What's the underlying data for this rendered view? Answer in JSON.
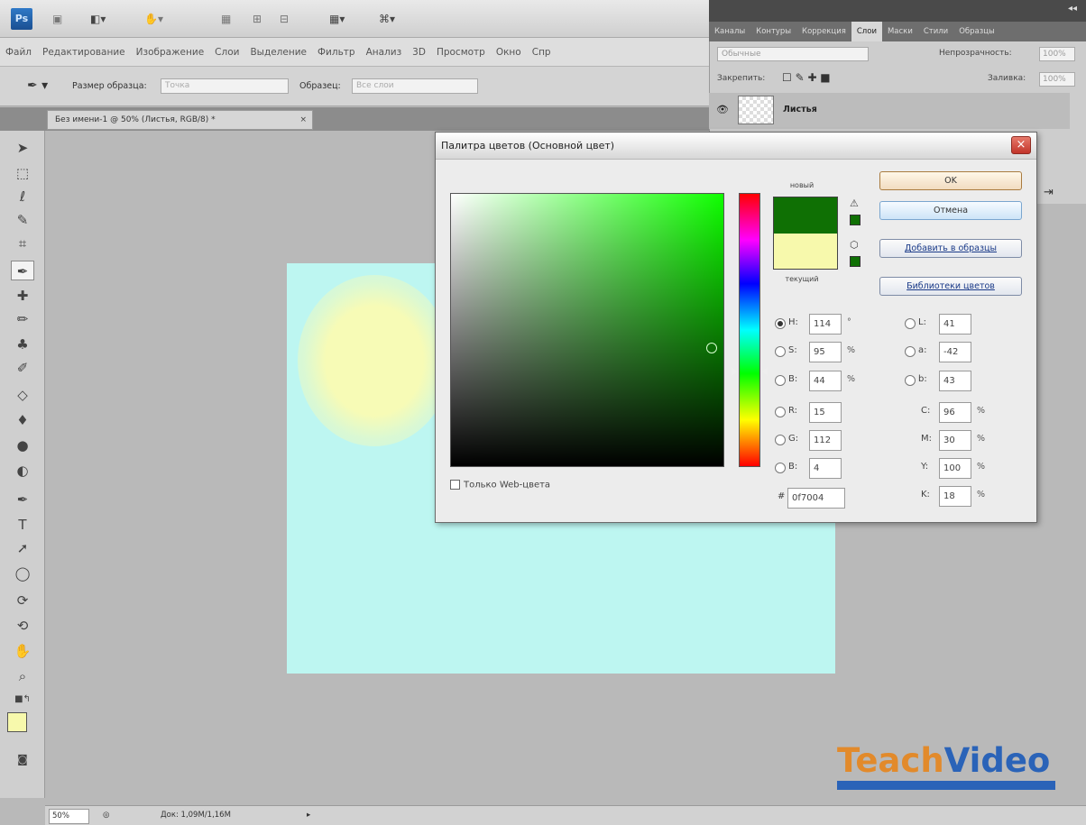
{
  "app": {
    "logo": "Ps",
    "menu": [
      "Файл",
      "Редактирование",
      "Изображение",
      "Слои",
      "Выделение",
      "Фильтр",
      "Анализ",
      "3D",
      "Просмотр",
      "Окно",
      "Спр"
    ],
    "options": {
      "sample_size_label": "Размер образца:",
      "sample_size_value": "Точка",
      "sample_label": "Образец:",
      "sample_value": "Все слои"
    }
  },
  "document": {
    "tab_title": "Без имени-1 @ 50% (Листья, RGB/8) *",
    "tab_close": "×",
    "zoom": "50%",
    "doc_info": "Док: 1,09М/1,16М",
    "canvas_color": "#bdf6f1",
    "blob_color": "#f7fbb6"
  },
  "panels": {
    "tabs": [
      "Каналы",
      "Контуры",
      "Коррекция",
      "Слои",
      "Маски",
      "Стили",
      "Образцы"
    ],
    "active_tab": "Слои",
    "blend_mode": "Обычные",
    "opacity_label": "Непрозрачность:",
    "opacity_value": "100%",
    "lock_label": "Закрепить:",
    "fill_label": "Заливка:",
    "fill_value": "100%",
    "layer_name": "Листья"
  },
  "dialog": {
    "title": "Палитра цветов (Основной цвет)",
    "close": "×",
    "new_label": "новый",
    "current_label": "текущий",
    "new_color": "#0f7004",
    "current_color": "#f7f9ac",
    "web_only_label": "Только Web-цвета",
    "buttons": {
      "ok": "OK",
      "cancel": "Отмена",
      "add_to_swatches": "Добавить в образцы",
      "color_libraries": "Библиотеки цветов"
    },
    "hsb": [
      {
        "label": "H:",
        "value": "114",
        "unit": "°",
        "selected": true
      },
      {
        "label": "S:",
        "value": "95",
        "unit": "%",
        "selected": false
      },
      {
        "label": "B:",
        "value": "44",
        "unit": "%",
        "selected": false
      }
    ],
    "rgb": [
      {
        "label": "R:",
        "value": "15"
      },
      {
        "label": "G:",
        "value": "112"
      },
      {
        "label": "B:",
        "value": "4"
      }
    ],
    "lab": [
      {
        "label": "L:",
        "value": "41"
      },
      {
        "label": "a:",
        "value": "-42"
      },
      {
        "label": "b:",
        "value": "43"
      }
    ],
    "cmyk": [
      {
        "label": "C:",
        "value": "96",
        "unit": "%"
      },
      {
        "label": "M:",
        "value": "30",
        "unit": "%"
      },
      {
        "label": "Y:",
        "value": "100",
        "unit": "%"
      },
      {
        "label": "K:",
        "value": "18",
        "unit": "%"
      }
    ],
    "hex_label": "#",
    "hex": "0f7004"
  },
  "watermark": {
    "brand_a": "Teach",
    "brand_b": "Video"
  }
}
